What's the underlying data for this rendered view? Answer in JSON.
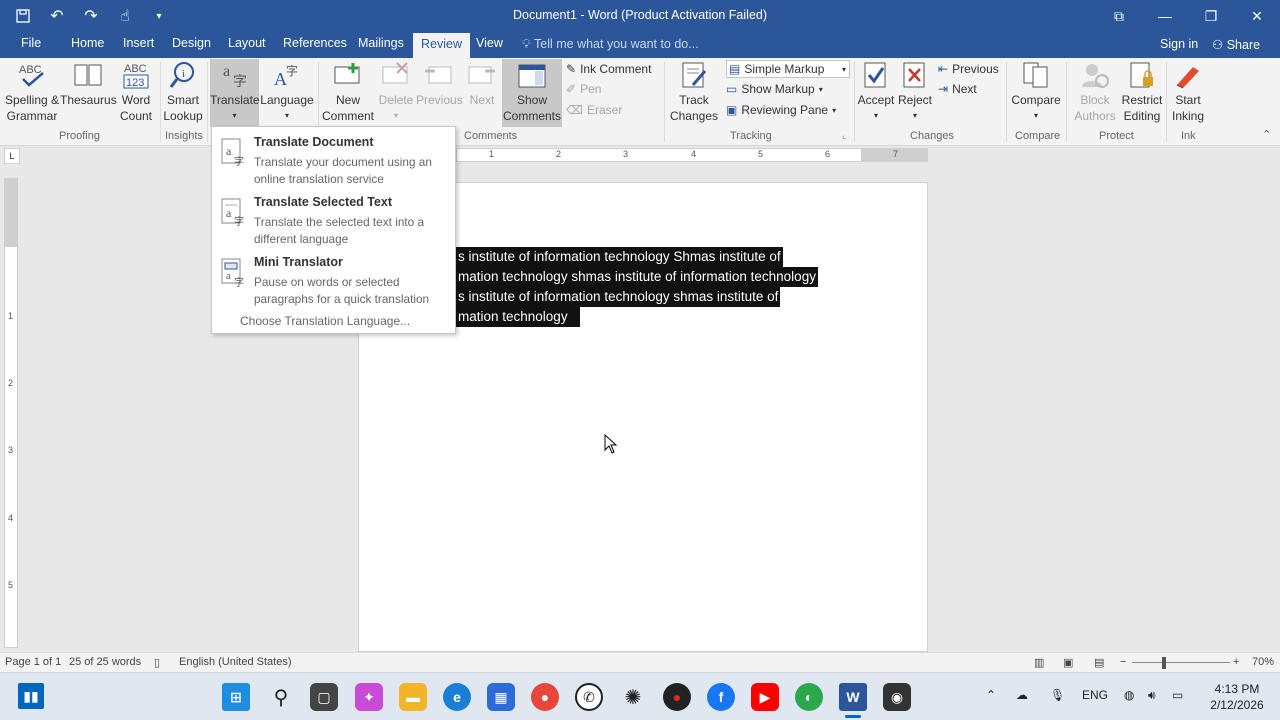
{
  "window": {
    "title": "Document1 - Word (Product Activation Failed)"
  },
  "menu": {
    "tabs": [
      {
        "label": "File"
      },
      {
        "label": "Home"
      },
      {
        "label": "Insert"
      },
      {
        "label": "Design"
      },
      {
        "label": "Layout"
      },
      {
        "label": "References"
      },
      {
        "label": "Mailings"
      },
      {
        "label": "Review",
        "active": true
      },
      {
        "label": "View"
      }
    ],
    "tell_me": "Tell me what you want to do...",
    "sign_in": "Sign in",
    "share": "Share"
  },
  "ribbon": {
    "buttons": {
      "spelling": "Spelling &\nGrammar",
      "thesaurus": "Thesaurus",
      "word_count": "Word\nCount",
      "smart_lookup": "Smart\nLookup",
      "translate": "Translate",
      "language": "Language",
      "new_comment": "New\nComment",
      "delete": "Delete",
      "previous": "Previous",
      "next": "Next",
      "show_comments": "Show\nComments",
      "ink_comment": "Ink Comment",
      "pen": "Pen",
      "eraser": "Eraser",
      "track_changes": "Track\nChanges",
      "simple_markup": "Simple Markup",
      "show_markup": "Show Markup",
      "reviewing_pane": "Reviewing Pane",
      "accept": "Accept",
      "reject": "Reject",
      "prev_change": "Previous",
      "next_change": "Next",
      "compare": "Compare",
      "block_authors": "Block\nAuthors",
      "restrict_editing": "Restrict\nEditing",
      "start_inking": "Start\nInking"
    },
    "groups": {
      "proofing": "Proofing",
      "insights": "Insights",
      "comments": "Comments",
      "tracking": "Tracking",
      "changes": "Changes",
      "compare": "Compare",
      "protect": "Protect",
      "ink": "Ink"
    }
  },
  "translate_menu": {
    "items": [
      {
        "title": "Translate Document",
        "desc": "Translate your document using an online translation service"
      },
      {
        "title": "Translate Selected Text",
        "desc": "Translate the selected text into a different language"
      },
      {
        "title": "Mini Translator",
        "desc": "Pause on words or selected paragraphs for a quick translation"
      }
    ],
    "choose_language": "Choose Translation Language..."
  },
  "document": {
    "lines": [
      "s  institute of information technology  Shmas  institute of",
      "mation technology shmas  institute of information technology",
      "s  institute of information technology shmas  institute of",
      "mation technology"
    ]
  },
  "ruler": {
    "h_numbers": [
      "1",
      "2",
      "3",
      "4",
      "5",
      "6",
      "7"
    ],
    "v_numbers": [
      "1",
      "2",
      "3",
      "4",
      "5"
    ]
  },
  "status": {
    "page": "Page 1 of 1",
    "words": "25 of 25 words",
    "language": "English (United States)",
    "zoom": "70%"
  },
  "taskbar": {
    "lang": "ENG",
    "time": "4:13 PM",
    "date": "2/12/2026"
  }
}
